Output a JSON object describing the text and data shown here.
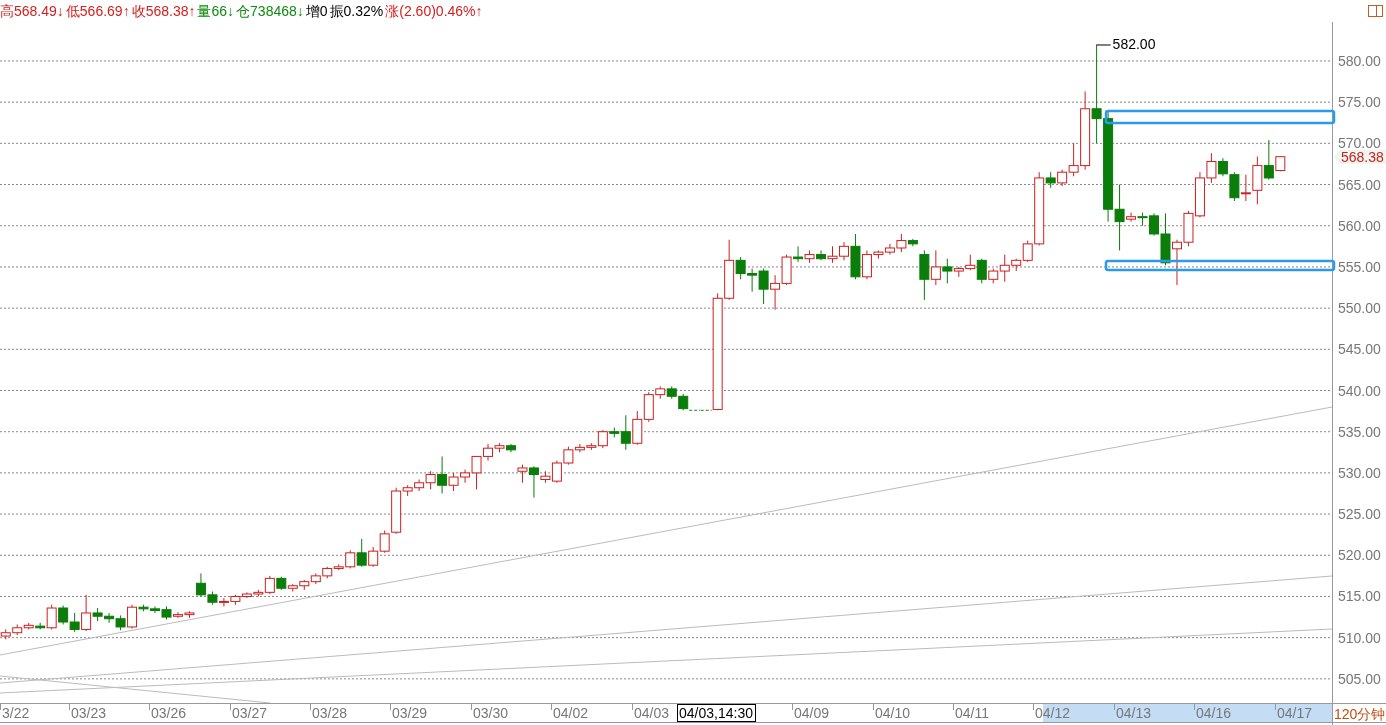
{
  "header": {
    "items": [
      {
        "text": "高568.49↓",
        "color": "#d42020"
      },
      {
        "text": "低566.69↑",
        "color": "#d42020"
      },
      {
        "text": "收568.38↑",
        "color": "#d42020"
      },
      {
        "text": "量66↓",
        "color": "#108a10"
      },
      {
        "text": "仓738468↓",
        "color": "#108a10"
      },
      {
        "text": "增0",
        "color": "#000000"
      },
      {
        "text": "振0.32%",
        "color": "#000000"
      },
      {
        "text": "涨(2.60)0.46%↑",
        "color": "#d42020"
      }
    ]
  },
  "chart": {
    "chart_data": {
      "type": "candlestick",
      "ylim": [
        499.4,
        587.4
      ],
      "categories": [
        null,
        "3/22",
        null,
        null,
        null,
        null,
        null,
        "03/23",
        null,
        null,
        null,
        null,
        null,
        null,
        "03/26",
        null,
        null,
        null,
        null,
        null,
        null,
        "03/27",
        null,
        null,
        null,
        null,
        null,
        null,
        "03/28",
        null,
        null,
        null,
        null,
        null,
        null,
        "03/29",
        null,
        null,
        null,
        null,
        null,
        null,
        "03/30",
        null,
        null,
        null,
        null,
        null,
        null,
        "04/02",
        null,
        null,
        null,
        null,
        null,
        null,
        "04/03",
        null,
        null,
        null,
        null,
        null,
        null,
        null,
        null,
        null,
        null,
        null,
        null,
        null,
        "04/09",
        null,
        null,
        null,
        null,
        null,
        null,
        "04/10",
        null,
        null,
        null,
        null,
        null,
        null,
        "04/11",
        null,
        null,
        null,
        null,
        null,
        null,
        "04/12",
        null,
        null,
        null,
        null,
        null,
        null,
        "04/13",
        null,
        null,
        null,
        null,
        null,
        null,
        "04/16",
        null,
        null,
        null,
        null,
        null,
        null,
        "04/17",
        null,
        null,
        null
      ],
      "yticks": [
        {
          "value": 580,
          "label": "580.00"
        },
        {
          "value": 575,
          "label": "575.00"
        },
        {
          "value": 570,
          "label": "570.00"
        },
        {
          "value": 565,
          "label": "565.00"
        },
        {
          "value": 560,
          "label": "560.00"
        },
        {
          "value": 555,
          "label": "555.00"
        },
        {
          "value": 550,
          "label": "550.00"
        },
        {
          "value": 545,
          "label": "545.00"
        },
        {
          "value": 540,
          "label": "540.00"
        },
        {
          "value": 535,
          "label": "535.00"
        },
        {
          "value": 530,
          "label": "530.00"
        },
        {
          "value": 525,
          "label": "525.00"
        },
        {
          "value": 520,
          "label": "520.00"
        },
        {
          "value": 515,
          "label": "515.00"
        },
        {
          "value": 510,
          "label": "510.00"
        },
        {
          "value": 505,
          "label": "505.00"
        }
      ],
      "annotations": [
        "582.00"
      ],
      "ohlc": [
        [
          510.2,
          511.0,
          509.8,
          510.6
        ],
        [
          510.6,
          511.6,
          510.3,
          511.2
        ],
        [
          511.2,
          511.8,
          511.0,
          511.5
        ],
        [
          511.4,
          511.8,
          511.0,
          511.2
        ],
        [
          511.2,
          514.0,
          511.0,
          513.6
        ],
        [
          513.6,
          513.9,
          511.6,
          511.9
        ],
        [
          511.9,
          513.0,
          510.7,
          511.0
        ],
        [
          511.0,
          515.2,
          510.8,
          513.0
        ],
        [
          513.0,
          513.6,
          512.0,
          512.6
        ],
        [
          512.6,
          513.0,
          511.8,
          512.3
        ],
        [
          512.3,
          512.7,
          510.9,
          511.3
        ],
        [
          511.3,
          514.0,
          511.1,
          513.7
        ],
        [
          513.7,
          514.0,
          513.2,
          513.5
        ],
        [
          513.5,
          513.8,
          513.0,
          513.3
        ],
        [
          513.4,
          513.8,
          512.2,
          512.5
        ],
        [
          512.6,
          513.1,
          512.4,
          512.8
        ],
        [
          512.8,
          513.2,
          512.4,
          513.0
        ],
        [
          516.6,
          517.8,
          515.0,
          515.2
        ],
        [
          515.2,
          515.6,
          514.0,
          514.3
        ],
        [
          514.3,
          514.8,
          513.8,
          514.4
        ],
        [
          514.4,
          515.2,
          514.0,
          515.0
        ],
        [
          515.0,
          515.5,
          514.8,
          515.3
        ],
        [
          515.3,
          515.8,
          515.0,
          515.5
        ],
        [
          515.5,
          517.5,
          515.3,
          517.2
        ],
        [
          517.2,
          517.4,
          515.8,
          516.0
        ],
        [
          516.0,
          516.5,
          515.6,
          516.3
        ],
        [
          516.3,
          517.0,
          515.8,
          516.8
        ],
        [
          516.8,
          517.8,
          516.5,
          517.5
        ],
        [
          517.5,
          518.6,
          517.2,
          518.4
        ],
        [
          518.4,
          518.9,
          518.2,
          518.6
        ],
        [
          518.6,
          520.6,
          518.4,
          520.3
        ],
        [
          520.3,
          522.0,
          518.6,
          518.8
        ],
        [
          518.8,
          521.0,
          518.6,
          520.5
        ],
        [
          520.5,
          523.0,
          520.3,
          522.6
        ],
        [
          522.8,
          528.2,
          522.6,
          527.8
        ],
        [
          527.8,
          528.5,
          527.2,
          528.2
        ],
        [
          528.2,
          529.2,
          527.8,
          528.8
        ],
        [
          528.8,
          530.2,
          528.0,
          529.8
        ],
        [
          529.8,
          532.0,
          527.5,
          528.5
        ],
        [
          528.5,
          530.0,
          527.8,
          529.5
        ],
        [
          529.5,
          530.4,
          528.8,
          530.0
        ],
        [
          530.0,
          532.0,
          528.0,
          532.0
        ],
        [
          532.0,
          533.5,
          531.5,
          533.0
        ],
        [
          533.0,
          533.6,
          532.5,
          533.3
        ],
        [
          533.3,
          533.5,
          532.5,
          532.8
        ],
        [
          530.2,
          531.0,
          528.8,
          530.6
        ],
        [
          530.6,
          530.8,
          527.0,
          529.8
        ],
        [
          529.2,
          530.2,
          528.8,
          529.6
        ],
        [
          529.0,
          531.5,
          528.8,
          531.2
        ],
        [
          531.2,
          533.2,
          531.0,
          532.8
        ],
        [
          532.8,
          533.5,
          532.5,
          533.1
        ],
        [
          533.1,
          533.6,
          532.8,
          533.3
        ],
        [
          533.3,
          535.2,
          533.0,
          535.0
        ],
        [
          535.0,
          535.5,
          534.3,
          534.8
        ],
        [
          535.0,
          537.0,
          532.8,
          533.6
        ],
        [
          533.6,
          537.5,
          533.4,
          536.5
        ],
        [
          536.5,
          539.8,
          536.2,
          539.5
        ],
        [
          539.5,
          540.5,
          539.0,
          540.2
        ],
        [
          540.2,
          540.5,
          539.0,
          539.3
        ],
        [
          539.3,
          539.6,
          537.6,
          537.8
        ],
        [
          537.6,
          537.6,
          537.6,
          537.6
        ],
        [
          537.6,
          537.6,
          537.6,
          537.6
        ],
        [
          537.7,
          551.8,
          537.6,
          551.2
        ],
        [
          551.2,
          558.3,
          551.0,
          555.8
        ],
        [
          555.8,
          556.2,
          553.5,
          554.2
        ],
        [
          554.2,
          554.8,
          552.0,
          554.0
        ],
        [
          554.5,
          554.8,
          550.5,
          552.3
        ],
        [
          552.3,
          554.0,
          549.8,
          553.0
        ],
        [
          553.0,
          556.5,
          552.8,
          556.2
        ],
        [
          556.2,
          557.5,
          555.6,
          556.0
        ],
        [
          556.0,
          557.0,
          555.5,
          556.5
        ],
        [
          556.5,
          557.0,
          555.8,
          556.0
        ],
        [
          556.0,
          557.5,
          555.5,
          556.3
        ],
        [
          556.3,
          558.0,
          555.8,
          557.5
        ],
        [
          557.5,
          559.0,
          553.5,
          553.8
        ],
        [
          553.8,
          557.0,
          553.5,
          556.5
        ],
        [
          556.5,
          557.0,
          556.0,
          556.8
        ],
        [
          556.8,
          557.8,
          556.5,
          557.3
        ],
        [
          557.3,
          559.0,
          556.8,
          558.2
        ],
        [
          558.2,
          558.4,
          557.5,
          557.8
        ],
        [
          556.5,
          557.0,
          551.0,
          553.5
        ],
        [
          553.5,
          557.0,
          552.8,
          555.0
        ],
        [
          555.0,
          556.0,
          553.0,
          554.5
        ],
        [
          554.5,
          555.0,
          553.8,
          554.8
        ],
        [
          554.8,
          556.5,
          554.6,
          555.2
        ],
        [
          555.8,
          556.0,
          553.0,
          553.5
        ],
        [
          553.5,
          554.8,
          553.0,
          554.5
        ],
        [
          554.5,
          556.5,
          553.2,
          555.2
        ],
        [
          555.2,
          556.0,
          554.5,
          555.8
        ],
        [
          555.8,
          558.2,
          555.6,
          557.8
        ],
        [
          557.8,
          566.5,
          557.6,
          565.8
        ],
        [
          565.8,
          566.5,
          564.6,
          565.2
        ],
        [
          565.2,
          566.8,
          564.8,
          566.5
        ],
        [
          566.5,
          570.0,
          566.0,
          567.3
        ],
        [
          567.3,
          576.3,
          566.8,
          574.2
        ],
        [
          574.2,
          582.0,
          570.0,
          573.0
        ],
        [
          573.0,
          574.0,
          560.5,
          562.0
        ],
        [
          562.0,
          565.0,
          557.0,
          560.5
        ],
        [
          560.8,
          561.6,
          560.5,
          561.1
        ],
        [
          561.1,
          561.6,
          560.0,
          561.0
        ],
        [
          561.2,
          561.5,
          558.8,
          559.0
        ],
        [
          559.0,
          561.5,
          555.2,
          555.5
        ],
        [
          557.2,
          558.3,
          552.8,
          558.0
        ],
        [
          558.0,
          561.8,
          557.5,
          561.5
        ],
        [
          561.2,
          566.5,
          561.0,
          565.8
        ],
        [
          565.8,
          568.8,
          565.2,
          567.8
        ],
        [
          567.8,
          568.2,
          566.0,
          566.3
        ],
        [
          566.2,
          566.5,
          563.0,
          563.4
        ],
        [
          564.0,
          566.2,
          563.0,
          564.0
        ],
        [
          564.3,
          568.4,
          562.6,
          567.3
        ],
        [
          567.3,
          570.4,
          565.6,
          565.8
        ],
        [
          566.7,
          568.4,
          566.6,
          568.38
        ],
        null,
        null,
        null,
        null
      ]
    }
  },
  "last_price": "568.38",
  "x_axis": {
    "cursor_label": "04/03,14:30",
    "period": "120分钟"
  }
}
